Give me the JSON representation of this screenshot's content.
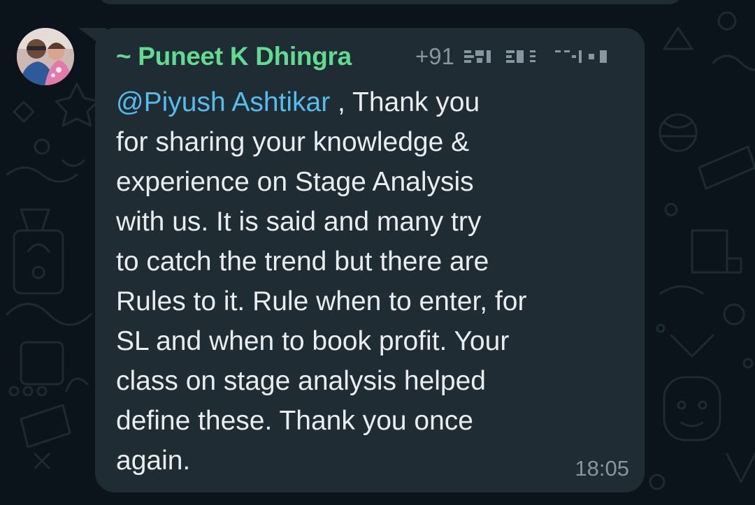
{
  "message": {
    "sender_name": "~ Puneet K Dhingra",
    "sender_phone_prefix": "+91",
    "mention": "@Piyush Ashtikar",
    "lines": [
      " , Thank you",
      "for sharing your knowledge &",
      "experience on Stage Analysis",
      "with us. It is said and many try",
      "to catch the trend but there are",
      "Rules to it. Rule when to enter, for",
      "SL and when to book profit. Your",
      "class on stage analysis helped",
      "define these. Thank you once",
      "again."
    ],
    "time": "18:05"
  },
  "colors": {
    "background": "#0b141a",
    "bubble": "#1f2c34",
    "sender_name": "#5fdc8f",
    "mention": "#53bdeb",
    "text": "#e9edef",
    "meta": "#8696a0"
  },
  "icons": {
    "avatar": "profile-photo",
    "wallpaper": "doodle-pattern"
  }
}
